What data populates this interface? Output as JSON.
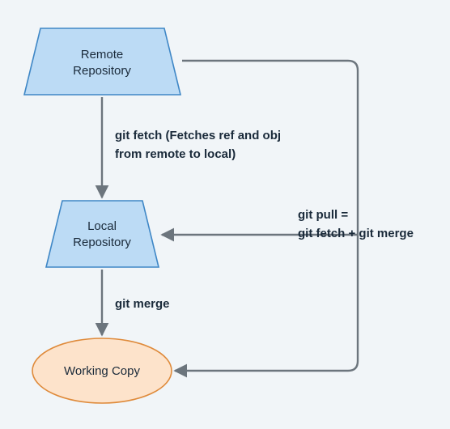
{
  "chart_data": {
    "type": "diagram",
    "nodes": [
      {
        "id": "remote",
        "shape": "trapezoid",
        "label_lines": [
          "Remote",
          "Repository"
        ]
      },
      {
        "id": "local",
        "shape": "trapezoid",
        "label_lines": [
          "Local",
          "Repository"
        ]
      },
      {
        "id": "working",
        "shape": "ellipse",
        "label_lines": [
          "Working Copy"
        ]
      }
    ],
    "edges": [
      {
        "from": "remote",
        "to": "local",
        "label_lines": [
          "git fetch (Fetches ref and obj",
          "from remote to local)"
        ]
      },
      {
        "from": "local",
        "to": "working",
        "label_lines": [
          "git merge"
        ]
      },
      {
        "from": "remote",
        "to": "working",
        "via": "right-bus",
        "label_lines": [
          "git pull =",
          "git fetch + git merge"
        ]
      },
      {
        "from": "right-bus",
        "to": "local",
        "label_lines": []
      }
    ]
  },
  "labels": {
    "remote_l1": "Remote",
    "remote_l2": "Repository",
    "local_l1": "Local",
    "local_l2": "Repository",
    "working_l1": "Working Copy",
    "fetch_l1": "git fetch (Fetches ref and obj",
    "fetch_l2": "from remote to local)",
    "merge_l1": "git merge",
    "pull_l1": "git pull =",
    "pull_l2": "git fetch + git merge"
  }
}
